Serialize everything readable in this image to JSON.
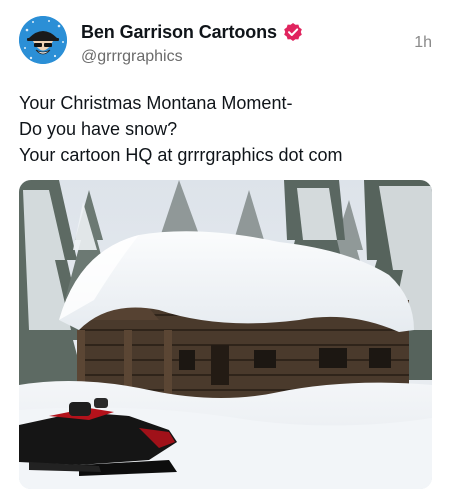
{
  "post": {
    "author": {
      "display_name": "Ben Garrison Cartoons",
      "handle": "@grrrgraphics",
      "verified": true,
      "avatar_icon": "cartoon-avatar-icon",
      "verified_icon": "verified-badge-icon",
      "verified_color": "#e0245e"
    },
    "timestamp": "1h",
    "text_lines": [
      "Your Christmas Montana Moment-",
      "Do you have snow?",
      "Your cartoon HQ at grrrgraphics dot com"
    ],
    "media": {
      "type": "photo",
      "icon": "snowy-log-cabin-photo"
    }
  }
}
